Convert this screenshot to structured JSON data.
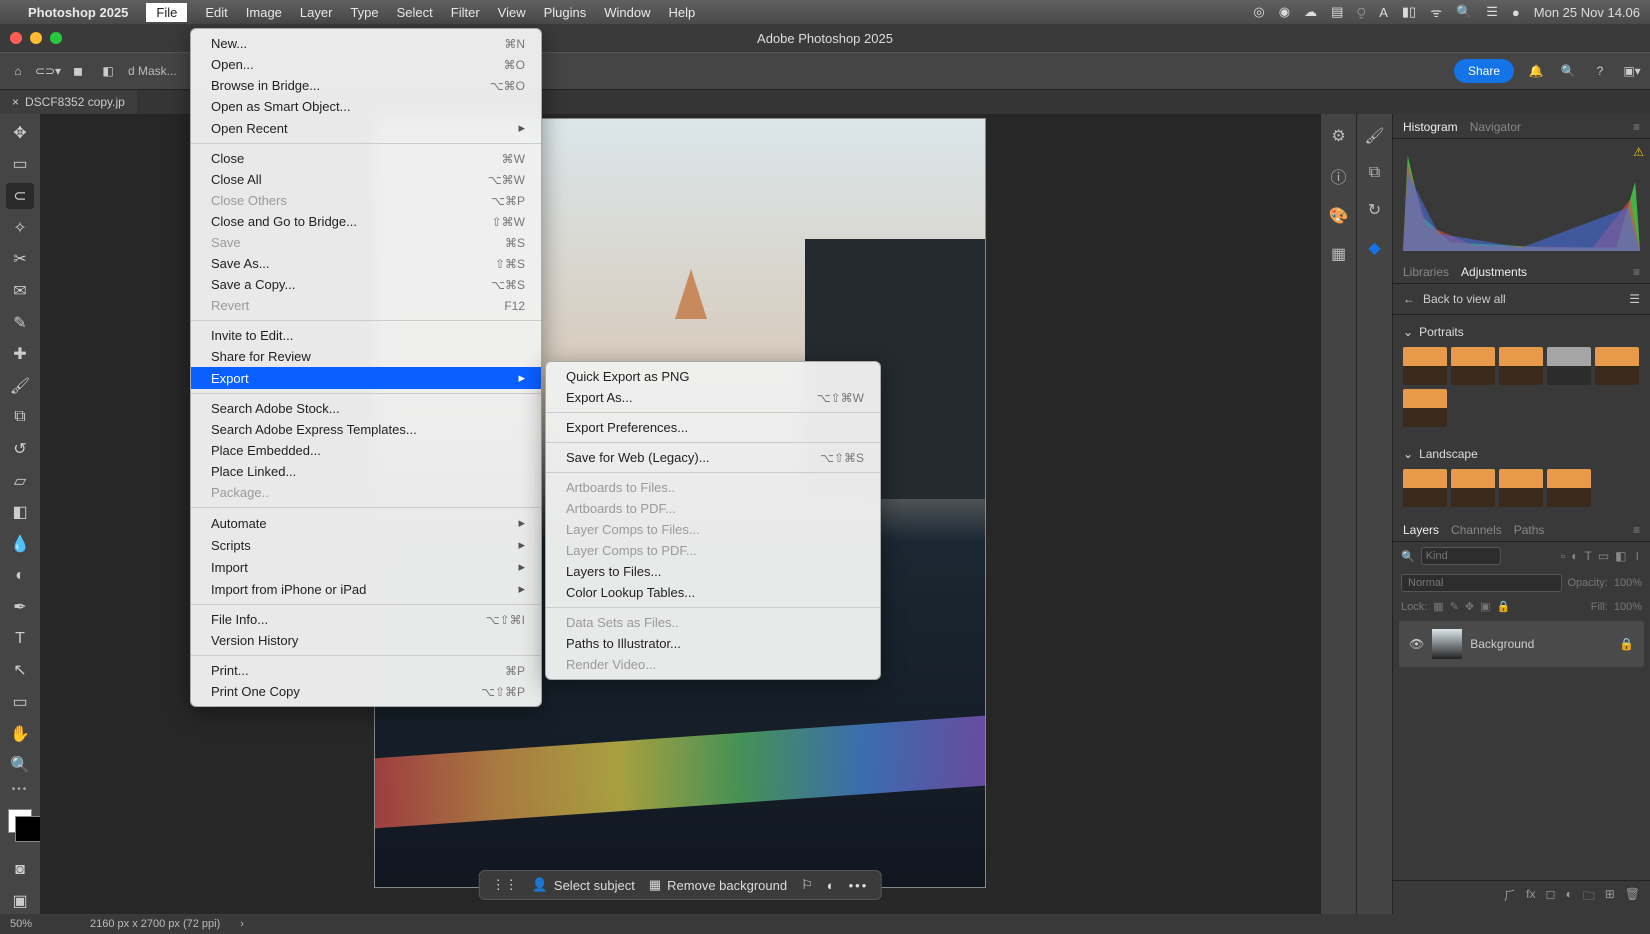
{
  "menubar": {
    "app_name": "Photoshop 2025",
    "items": [
      "File",
      "Edit",
      "Image",
      "Layer",
      "Type",
      "Select",
      "Filter",
      "View",
      "Plugins",
      "Window",
      "Help"
    ],
    "active_index": 0,
    "clock": "Mon 25 Nov  14.06"
  },
  "window": {
    "title": "Adobe Photoshop 2025"
  },
  "optionsbar": {
    "mask_btn": "d Mask...",
    "share": "Share"
  },
  "document_tab": {
    "label": "DSCF8352 copy.jp",
    "close": "×"
  },
  "file_menu": {
    "groups": [
      [
        {
          "label": "New...",
          "shortcut": "⌘N"
        },
        {
          "label": "Open...",
          "shortcut": "⌘O"
        },
        {
          "label": "Browse in Bridge...",
          "shortcut": "⌥⌘O"
        },
        {
          "label": "Open as Smart Object..."
        },
        {
          "label": "Open Recent",
          "submenu": true
        }
      ],
      [
        {
          "label": "Close",
          "shortcut": "⌘W"
        },
        {
          "label": "Close All",
          "shortcut": "⌥⌘W"
        },
        {
          "label": "Close Others",
          "shortcut": "⌥⌘P",
          "disabled": true
        },
        {
          "label": "Close and Go to Bridge...",
          "shortcut": "⇧⌘W"
        },
        {
          "label": "Save",
          "shortcut": "⌘S",
          "disabled": true
        },
        {
          "label": "Save As...",
          "shortcut": "⇧⌘S"
        },
        {
          "label": "Save a Copy...",
          "shortcut": "⌥⌘S"
        },
        {
          "label": "Revert",
          "shortcut": "F12",
          "disabled": true
        }
      ],
      [
        {
          "label": "Invite to Edit..."
        },
        {
          "label": "Share for Review"
        },
        {
          "label": "Export",
          "submenu": true,
          "highlight": true
        }
      ],
      [
        {
          "label": "Search Adobe Stock..."
        },
        {
          "label": "Search Adobe Express Templates..."
        },
        {
          "label": "Place Embedded..."
        },
        {
          "label": "Place Linked..."
        },
        {
          "label": "Package..",
          "disabled": true
        }
      ],
      [
        {
          "label": "Automate",
          "submenu": true
        },
        {
          "label": "Scripts",
          "submenu": true
        },
        {
          "label": "Import",
          "submenu": true
        },
        {
          "label": "Import from iPhone or iPad",
          "submenu": true
        }
      ],
      [
        {
          "label": "File Info...",
          "shortcut": "⌥⇧⌘I"
        },
        {
          "label": "Version History"
        }
      ],
      [
        {
          "label": "Print...",
          "shortcut": "⌘P"
        },
        {
          "label": "Print One Copy",
          "shortcut": "⌥⇧⌘P"
        }
      ]
    ]
  },
  "export_menu": {
    "groups": [
      [
        {
          "label": "Quick Export as PNG"
        },
        {
          "label": "Export As...",
          "shortcut": "⌥⇧⌘W"
        }
      ],
      [
        {
          "label": "Export Preferences..."
        }
      ],
      [
        {
          "label": "Save for Web (Legacy)...",
          "shortcut": "⌥⇧⌘S"
        }
      ],
      [
        {
          "label": "Artboards to Files..",
          "disabled": true
        },
        {
          "label": "Artboards to PDF...",
          "disabled": true
        },
        {
          "label": "Layer Comps to Files...",
          "disabled": true
        },
        {
          "label": "Layer Comps to PDF...",
          "disabled": true
        },
        {
          "label": "Layers to Files..."
        },
        {
          "label": "Color Lookup Tables..."
        }
      ],
      [
        {
          "label": "Data Sets as Files..",
          "disabled": true
        },
        {
          "label": "Paths to Illustrator..."
        },
        {
          "label": "Render Video...",
          "disabled": true
        }
      ]
    ]
  },
  "ctx": {
    "select_subject": "Select subject",
    "remove_bg": "Remove background"
  },
  "panels": {
    "histogram_tab": "Histogram",
    "navigator_tab": "Navigator",
    "libraries_tab": "Libraries",
    "adjustments_tab": "Adjustments",
    "back_to_view": "Back to view all",
    "portraits": "Portraits",
    "landscape": "Landscape",
    "layers_tab": "Layers",
    "channels_tab": "Channels",
    "paths_tab": "Paths",
    "kind_placeholder": "Kind",
    "blend_mode": "Normal",
    "opacity_label": "Opacity:",
    "opacity_val": "100%",
    "lock_label": "Lock:",
    "fill_label": "Fill:",
    "fill_val": "100%",
    "layer_name": "Background"
  },
  "status": {
    "zoom": "50%",
    "dims": "2160 px x 2700 px (72 ppi)"
  }
}
